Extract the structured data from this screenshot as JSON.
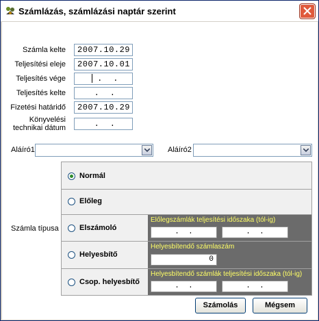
{
  "window": {
    "title": "Számlázás, számlázási naptár szerint"
  },
  "dates": {
    "szamla_kelte": {
      "label": "Számla kelte",
      "value": "2007.10.29"
    },
    "teljesitesi_eleje": {
      "label": "Teljesítési eleje",
      "value": "2007.10.01"
    },
    "teljesites_vege": {
      "label": "Teljesítés vége",
      "value": ".  ."
    },
    "teljesites_kelte": {
      "label": "Teljesítés kelte",
      "value": ".  ."
    },
    "fizetesi_hatarido": {
      "label": "Fizetési határidő",
      "value": "2007.10.29"
    },
    "konyvelesi_datum": {
      "label_line1": "Könyvelési",
      "label_line2": "technikai dátum",
      "value": ".  ."
    }
  },
  "signers": {
    "alairo1": {
      "label": "Aláíró1",
      "value": ""
    },
    "alairo2": {
      "label": "Aláíró2",
      "value": ""
    }
  },
  "invoice_type": {
    "label": "Számla típusa",
    "selected": "Normál",
    "options": [
      {
        "label": "Normál"
      },
      {
        "label": "Előleg"
      },
      {
        "label": "Elszámoló",
        "panel_label": "Előlegszámlák teljesítési időszaka (tól-ig)",
        "from": ".  .",
        "to": ".  ."
      },
      {
        "label": "Helyesbítő",
        "panel_label": "Helyesbítendő számlaszám",
        "value": "0"
      },
      {
        "label": "Csop. helyesbítő",
        "panel_label": "Helyesbítendő számlák teljesítési időszaka (tól-ig)",
        "from": ".  .",
        "to": ".  ."
      }
    ]
  },
  "buttons": {
    "calculate": "Számolás",
    "cancel": "Mégsem"
  },
  "colors": {
    "panel": "#6b6b6b",
    "panel_label": "#ffff66",
    "radio_selected": "#2d8a2d"
  }
}
